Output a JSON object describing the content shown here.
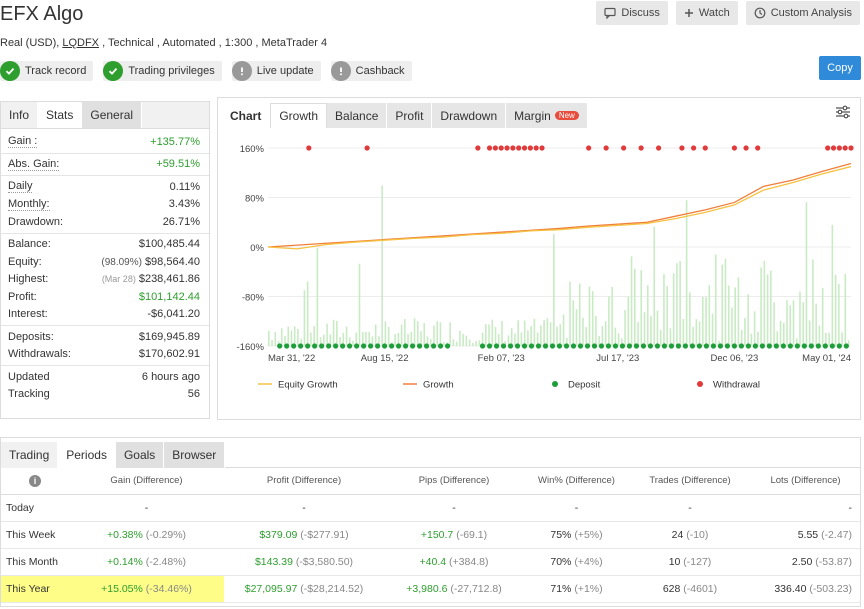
{
  "header": {
    "title": "EFX Algo",
    "subtitle_prefix": "Real (USD), ",
    "broker": "LQDFX",
    "subtitle_suffix": " , Technical , Automated , 1:300 , MetaTrader 4",
    "discuss_label": "Discuss",
    "watch_label": "Watch",
    "custom_analysis_label": "Custom Analysis",
    "copy_label": "Copy"
  },
  "badges": [
    {
      "label": "Track record",
      "status": "verified",
      "color": "#2e9e2e"
    },
    {
      "label": "Trading privileges",
      "status": "verified",
      "color": "#2e9e2e"
    },
    {
      "label": "Live update",
      "status": "info",
      "color": "#999999"
    },
    {
      "label": "Cashback",
      "status": "info",
      "color": "#999999"
    }
  ],
  "info_panel": {
    "tabs": [
      "Info",
      "Stats",
      "General"
    ],
    "rows": {
      "gain": {
        "label": "Gain :",
        "value": "+135.77%"
      },
      "abs_gain": {
        "label": "Abs. Gain:",
        "value": "+59.51%"
      },
      "daily": {
        "label": "Daily",
        "value": "0.11%"
      },
      "monthly": {
        "label": "Monthly:",
        "value": "3.43%"
      },
      "drawdown": {
        "label": "Drawdown:",
        "value": "26.71%"
      },
      "balance": {
        "label": "Balance:",
        "value": "$100,485.44"
      },
      "equity": {
        "label": "Equity:",
        "note": "(98.09%)",
        "value": "$98,564.40"
      },
      "highest": {
        "label": "Highest:",
        "note": "(Mar 28)",
        "value": "$238,461.86"
      },
      "profit": {
        "label": "Profit:",
        "value": "$101,142.44"
      },
      "interest": {
        "label": "Interest:",
        "value": "-$6,041.20"
      },
      "deposits": {
        "label": "Deposits:",
        "value": "$169,945.89"
      },
      "withdrawals": {
        "label": "Withdrawals:",
        "value": "$170,602.91"
      },
      "updated": {
        "label": "Updated",
        "value": "6 hours ago"
      },
      "tracking": {
        "label": "Tracking",
        "value": "56"
      }
    }
  },
  "chart_panel": {
    "tabs": [
      "Chart",
      "Growth",
      "Balance",
      "Profit",
      "Drawdown",
      "Margin"
    ],
    "new_label": "New"
  },
  "chart_data": {
    "type": "line",
    "y_ticks": [
      "160%",
      "80%",
      "0%",
      "-80%",
      "-160%"
    ],
    "ylim": [
      -160,
      160
    ],
    "x_ticks": [
      "Mar 31, '22",
      "Aug 15, '22",
      "Feb 07, '23",
      "Jul 17, '23",
      "Dec 06, '23",
      "May 01, '24"
    ],
    "legend": [
      "Equity Growth",
      "Growth",
      "Deposit",
      "Withdrawal"
    ],
    "colors": {
      "equity": "#f5c242",
      "growth": "#f07f3c",
      "deposit": "#1e9e3a",
      "withdrawal": "#e03a3a",
      "bars": "#c9ebc4"
    },
    "series": [
      {
        "name": "Growth",
        "x": [
          0,
          0.1,
          0.2,
          0.3,
          0.4,
          0.5,
          0.55,
          0.6,
          0.65,
          0.7,
          0.75,
          0.8,
          0.85,
          0.9,
          0.95,
          1.0
        ],
        "values": [
          0,
          6,
          12,
          18,
          24,
          30,
          34,
          37,
          40,
          50,
          60,
          72,
          98,
          108,
          122,
          135
        ]
      },
      {
        "name": "Equity Growth",
        "x": [
          0,
          0.05,
          0.1,
          0.15,
          0.2,
          0.25,
          0.3,
          0.35,
          0.4,
          0.45,
          0.5,
          0.55,
          0.6,
          0.65,
          0.7,
          0.75,
          0.8,
          0.85,
          0.9,
          0.95,
          1.0
        ],
        "values": [
          0,
          -3,
          4,
          8,
          11,
          14,
          16,
          20,
          22,
          26,
          28,
          32,
          35,
          38,
          46,
          56,
          68,
          92,
          104,
          118,
          130
        ]
      }
    ]
  },
  "periods_panel": {
    "tabs": [
      "Trading",
      "Periods",
      "Goals",
      "Browser"
    ],
    "headers": [
      "Gain (Difference)",
      "Profit (Difference)",
      "Pips (Difference)",
      "Win% (Difference)",
      "Trades (Difference)",
      "Lots (Difference)"
    ],
    "rows": [
      {
        "label": "Today",
        "gain": "-",
        "gain_d": "",
        "profit": "-",
        "profit_d": "",
        "pips": "-",
        "pips_d": "",
        "win": "-",
        "win_d": "",
        "trades": "-",
        "trades_d": "",
        "lots": "-",
        "lots_d": ""
      },
      {
        "label": "This Week",
        "gain": "+0.38%",
        "gain_d": "(-0.29%)",
        "profit": "$379.09",
        "profit_d": "(-$277.91)",
        "pips": "+150.7",
        "pips_d": "(-69.1)",
        "win": "75%",
        "win_d": "(+5%)",
        "trades": "24",
        "trades_d": "(-10)",
        "lots": "5.55",
        "lots_d": "(-2.47)"
      },
      {
        "label": "This Month",
        "gain": "+0.14%",
        "gain_d": "(-2.48%)",
        "profit": "$143.39",
        "profit_d": "(-$3,580.50)",
        "pips": "+40.4",
        "pips_d": "(+384.8)",
        "win": "70%",
        "win_d": "(+4%)",
        "trades": "10",
        "trades_d": "(-127)",
        "lots": "2.50",
        "lots_d": "(-53.87)"
      },
      {
        "label": "This Year",
        "gain": "+15.05%",
        "gain_d": "(-34.46%)",
        "profit": "$27,095.97",
        "profit_d": "(-$28,214.52)",
        "pips": "+3,980.6",
        "pips_d": "(-27,712.8)",
        "win": "71%",
        "win_d": "(+1%)",
        "trades": "628",
        "trades_d": "(-4601)",
        "lots": "336.40",
        "lots_d": "(-503.23)"
      }
    ]
  }
}
